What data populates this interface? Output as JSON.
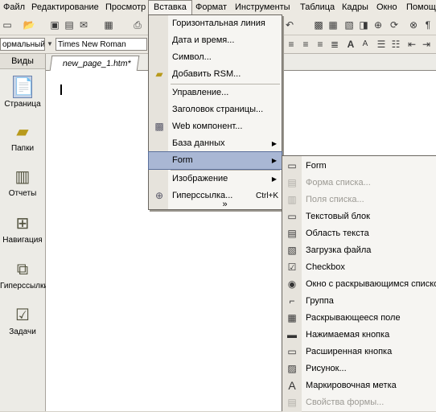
{
  "menubar": {
    "items": [
      "Файл",
      "Редактирование",
      "Просмотр",
      "Вставка",
      "Формат",
      "Инструменты",
      "Таблица",
      "Кадры",
      "Окно",
      "Помощь"
    ]
  },
  "toolbar": {
    "style_combo": "ормальный",
    "font_combo": "Times New Roman"
  },
  "views": {
    "title": "Виды",
    "items": [
      {
        "label": "Страница",
        "icon": "page-view-icon"
      },
      {
        "label": "Папки",
        "icon": "folders-view-icon"
      },
      {
        "label": "Отчеты",
        "icon": "reports-view-icon"
      },
      {
        "label": "Навигация",
        "icon": "navigation-view-icon"
      },
      {
        "label": "Гиперссылки",
        "icon": "hyperlinks-view-icon"
      },
      {
        "label": "Задачи",
        "icon": "tasks-view-icon"
      }
    ]
  },
  "document": {
    "tab_label": "new_page_1.htm*"
  },
  "insert_menu": {
    "items": [
      {
        "label": "Горизонтальная линия"
      },
      {
        "label": "Дата и время..."
      },
      {
        "label": "Символ..."
      },
      {
        "label": "Добавить RSM..."
      },
      {
        "label": "Управление..."
      },
      {
        "label": "Заголовок страницы..."
      },
      {
        "label": "Web компонент..."
      },
      {
        "label": "База данных"
      },
      {
        "label": "Form"
      },
      {
        "label": "Изображение"
      },
      {
        "label": "Гиперссылка...",
        "shortcut": "Ctrl+K"
      }
    ],
    "expand": "»"
  },
  "form_menu": {
    "items": [
      {
        "label": "Form",
        "enabled": true
      },
      {
        "label": "Форма списка...",
        "enabled": false
      },
      {
        "label": "Поля списка...",
        "enabled": false
      },
      {
        "label": "Текстовый блок",
        "enabled": true
      },
      {
        "label": "Область текста",
        "enabled": true
      },
      {
        "label": "Загрузка файла",
        "enabled": true
      },
      {
        "label": "Checkbox",
        "enabled": true
      },
      {
        "label": "Окно с раскрывающимся списком",
        "enabled": true
      },
      {
        "label": "Группа",
        "enabled": true
      },
      {
        "label": "Раскрывающееся поле",
        "enabled": true
      },
      {
        "label": "Нажимаемая кнопка",
        "enabled": true
      },
      {
        "label": "Расширенная кнопка",
        "enabled": true
      },
      {
        "label": "Рисунок...",
        "enabled": true
      },
      {
        "label": "Маркировочная метка",
        "enabled": true
      },
      {
        "label": "Свойства формы...",
        "enabled": false
      }
    ]
  }
}
